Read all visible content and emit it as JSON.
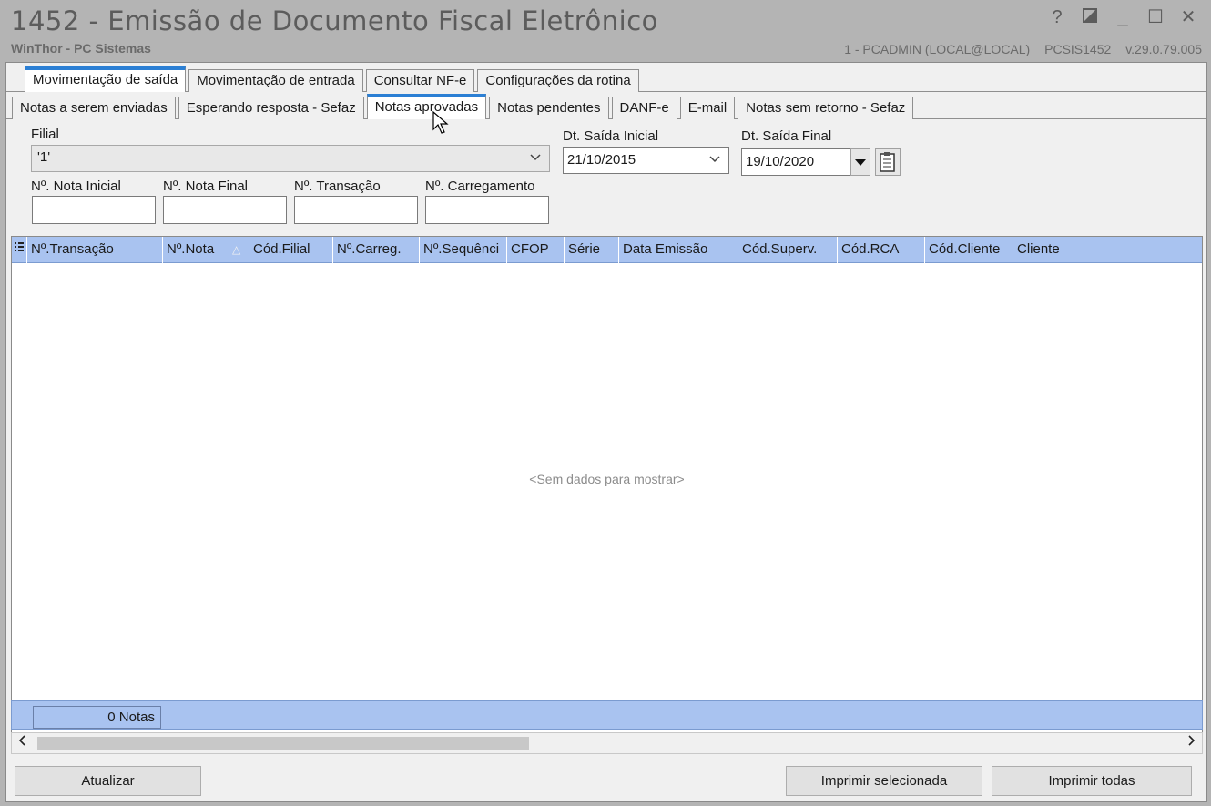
{
  "window": {
    "title": "1452 - Emissão de Documento Fiscal Eletrônico",
    "subtitle": "WinThor - PC Sistemas",
    "user": "1 - PCADMIN (LOCAL@LOCAL)",
    "routine": "PCSIS1452",
    "version": "v.29.0.79.005",
    "help_glyph": "?",
    "minimize_glyph": "_",
    "maximize_glyph": "☐",
    "close_glyph": "✕"
  },
  "tabs_main": [
    {
      "label": "Movimentação de saída",
      "active": true
    },
    {
      "label": "Movimentação de entrada",
      "active": false
    },
    {
      "label": "Consultar NF-e",
      "active": false
    },
    {
      "label": "Configurações da rotina",
      "active": false
    }
  ],
  "tabs_sub": [
    {
      "label": "Notas a serem enviadas",
      "active": false
    },
    {
      "label": "Esperando resposta - Sefaz",
      "active": false
    },
    {
      "label": "Notas aprovadas",
      "active": true
    },
    {
      "label": "Notas pendentes",
      "active": false
    },
    {
      "label": "DANF-e",
      "active": false
    },
    {
      "label": "E-mail",
      "active": false
    },
    {
      "label": "Notas sem retorno - Sefaz",
      "active": false
    }
  ],
  "filters": {
    "filial_label": "Filial",
    "filial_value": "'1'",
    "dt_inicial_label": "Dt. Saída Inicial",
    "dt_inicial_value": "21/10/2015",
    "dt_final_label": "Dt. Saída Final",
    "dt_final_value": "19/10/2020",
    "nota_inicial_label": "Nº. Nota Inicial",
    "nota_final_label": "Nº. Nota Final",
    "transacao_label": "Nº. Transação",
    "carregamento_label": "Nº. Carregamento"
  },
  "grid": {
    "columns": [
      "Nº.Transação",
      "Nº.Nota",
      "Cód.Filial",
      "Nº.Carreg.",
      "Nº.Sequênci",
      "CFOP",
      "Série",
      "Data Emissão",
      "Cód.Superv.",
      "Cód.RCA",
      "Cód.Cliente",
      "Cliente"
    ],
    "empty_message": "<Sem dados para mostrar>",
    "sort_glyph": "△",
    "footer_count": "0 Notas"
  },
  "buttons": {
    "atualizar": "Atualizar",
    "imprimir_selecionada": "Imprimir selecionada",
    "imprimir_todas": "Imprimir todas"
  },
  "colors": {
    "accent_tab": "#2b7fd4",
    "grid_header": "#a9c3f0",
    "titlebar": "#b4b4b4"
  },
  "icons": {
    "column_chooser": "column-chooser-icon",
    "dropdown": "chevron-down-icon",
    "calendar": "calendar-icon",
    "scroll_left": "scroll-left-icon",
    "scroll_right": "scroll-right-icon"
  }
}
